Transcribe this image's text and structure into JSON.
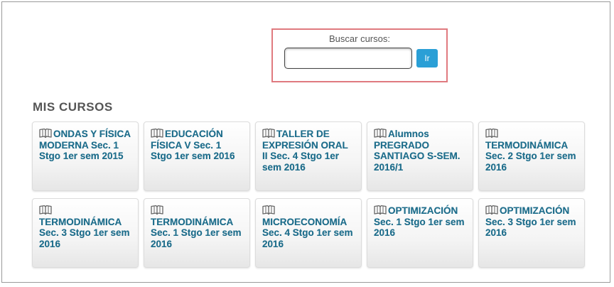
{
  "search": {
    "label": "Buscar cursos:",
    "value": "",
    "placeholder": "",
    "button_label": "Ir"
  },
  "section": {
    "title": "MIS CURSOS"
  },
  "courses": [
    {
      "name": "ONDAS Y FÍSICA MODERNA Sec. 1 Stgo 1er sem 2015",
      "icon": "book-icon"
    },
    {
      "name": "EDUCACIÓN FÍSICA V Sec. 1 Stgo 1er sem 2016",
      "icon": "book-icon"
    },
    {
      "name": "TALLER DE EXPRESIÓN ORAL II Sec. 4 Stgo 1er sem 2016",
      "icon": "book-icon"
    },
    {
      "name": "Alumnos PREGRADO SANTIAGO S-SEM. 2016/1",
      "icon": "book-icon"
    },
    {
      "name": "TERMODINÁMICA Sec. 2 Stgo 1er sem 2016",
      "icon": "book-icon"
    },
    {
      "name": "TERMODINÁMICA Sec. 3 Stgo 1er sem 2016",
      "icon": "book-icon"
    },
    {
      "name": "TERMODINÁMICA Sec. 1 Stgo 1er sem 2016",
      "icon": "book-icon"
    },
    {
      "name": "MICROECONOMÍA Sec. 4 Stgo 1er sem 2016",
      "icon": "book-icon"
    },
    {
      "name": "OPTIMIZACIÓN Sec. 1 Stgo 1er sem 2016",
      "icon": "book-icon"
    },
    {
      "name": "OPTIMIZACIÓN Sec. 3 Stgo 1er sem 2016",
      "icon": "book-icon"
    }
  ],
  "colors": {
    "link": "#1f6e8c",
    "button": "#2a9fd6",
    "highlight_border": "#e07a7f"
  }
}
